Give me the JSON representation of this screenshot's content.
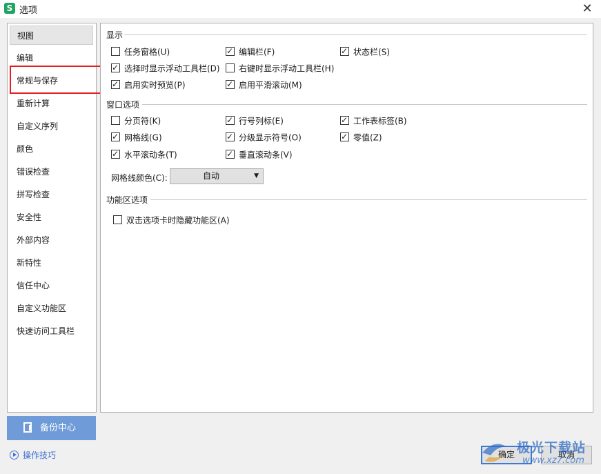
{
  "window": {
    "icon_letter": "S",
    "title": "选项",
    "close_label": "✕"
  },
  "sidebar": {
    "items": [
      {
        "label": "视图",
        "active": true
      },
      {
        "label": "编辑"
      },
      {
        "label": "常规与保存"
      },
      {
        "label": "重新计算"
      },
      {
        "label": "自定义序列"
      },
      {
        "label": "颜色"
      },
      {
        "label": "错误检查"
      },
      {
        "label": "拼写检查"
      },
      {
        "label": "安全性"
      },
      {
        "label": "外部内容"
      },
      {
        "label": "新特性"
      },
      {
        "label": "信任中心"
      },
      {
        "label": "自定义功能区"
      },
      {
        "label": "快速访问工具栏"
      }
    ]
  },
  "sections": {
    "display": {
      "title": "显示",
      "options": [
        {
          "label": "任务窗格(U)",
          "checked": false
        },
        {
          "label": "编辑栏(F)",
          "checked": true
        },
        {
          "label": "状态栏(S)",
          "checked": true
        },
        {
          "label": "选择时显示浮动工具栏(D)",
          "checked": true
        },
        {
          "label": "右键时显示浮动工具栏(H)",
          "checked": false
        },
        {
          "label": "启用实时预览(P)",
          "checked": true
        },
        {
          "label": "启用平滑滚动(M)",
          "checked": true
        }
      ]
    },
    "window": {
      "title": "窗口选项",
      "options": [
        {
          "label": "分页符(K)",
          "checked": false
        },
        {
          "label": "行号列标(E)",
          "checked": true
        },
        {
          "label": "工作表标签(B)",
          "checked": true
        },
        {
          "label": "网格线(G)",
          "checked": true
        },
        {
          "label": "分级显示符号(O)",
          "checked": true
        },
        {
          "label": "零值(Z)",
          "checked": true
        },
        {
          "label": "水平滚动条(T)",
          "checked": true
        },
        {
          "label": "垂直滚动条(V)",
          "checked": true
        }
      ],
      "gridline_color_label": "网格线颜色(C):",
      "gridline_color_value": "自动"
    },
    "ribbon": {
      "title": "功能区选项",
      "options": [
        {
          "label": "双击选项卡时隐藏功能区(A)",
          "checked": false
        }
      ]
    }
  },
  "footer": {
    "backup_label": "备份中心",
    "tips_label": "操作技巧",
    "ok_label": "确定",
    "cancel_label": "取消"
  },
  "watermark": {
    "text": "极光下载站",
    "url": "www.xz7.com"
  },
  "colors": {
    "accent": "#6f9bd8",
    "link": "#3d6ed1",
    "highlight": "#e21f1f",
    "app_icon": "#1fa463"
  }
}
